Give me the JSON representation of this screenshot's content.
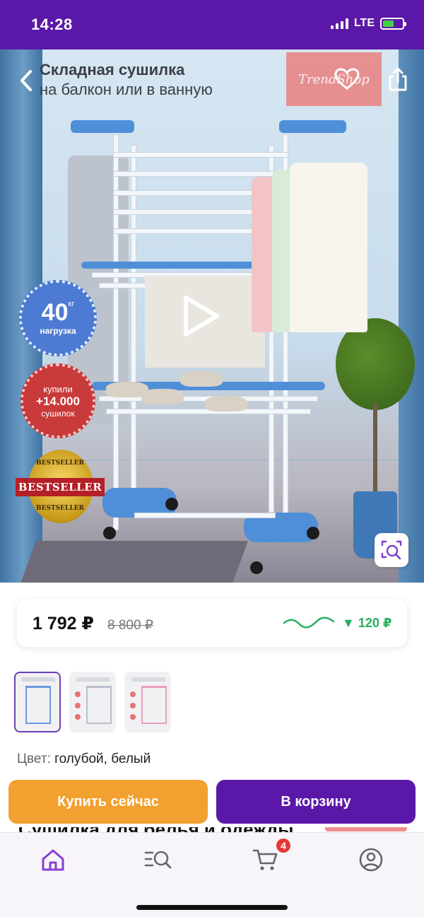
{
  "status_bar": {
    "time": "14:28",
    "network": "LTE",
    "battery_level": 0.6,
    "signal_bars": 4
  },
  "header": {
    "title_line1": "Складная сушилка",
    "title_line2": "на балкон или в ванную",
    "brand_logo_text": "TrendShop",
    "back_icon": "chevron-left-icon",
    "favorite_icon": "heart-icon",
    "share_icon": "share-icon"
  },
  "hero": {
    "play_icon": "play-icon",
    "zoom_icon": "image-search-icon",
    "badge_weight": {
      "value": "40",
      "unit": "кг",
      "label": "нагрузка"
    },
    "badge_sold": {
      "line1": "купили",
      "line2": "+14.000",
      "line3": "сушилок"
    },
    "badge_bestseller": {
      "ribbon": "BESTSELLER",
      "arc_top": "BESTSELLER",
      "arc_bottom": "BESTSELLER"
    }
  },
  "price": {
    "current": "1 792 ₽",
    "old": "8 800 ₽",
    "change": "▼ 120 ₽",
    "trend_color": "#27ae60"
  },
  "thumbnails": [
    {
      "label": "",
      "active": true
    },
    {
      "label": "",
      "active": false
    },
    {
      "label": "",
      "active": false
    }
  ],
  "color": {
    "label": "Цвет:",
    "value": "голубой, белый"
  },
  "peek": {
    "title": "Сушилка для белья и одежды"
  },
  "actions": {
    "buy_now": "Купить сейчас",
    "add_to_cart": "В корзину"
  },
  "tabbar": {
    "items": [
      {
        "name": "home",
        "icon": "home-icon",
        "active": true
      },
      {
        "name": "search",
        "icon": "search-icon",
        "active": false
      },
      {
        "name": "cart",
        "icon": "cart-icon",
        "active": false
      },
      {
        "name": "profile",
        "icon": "profile-icon",
        "active": false
      }
    ],
    "cart_badge": "4"
  },
  "colors": {
    "brand_purple": "#5b18a8",
    "buy_orange": "#f2a030",
    "badge_red": "#e53935"
  }
}
